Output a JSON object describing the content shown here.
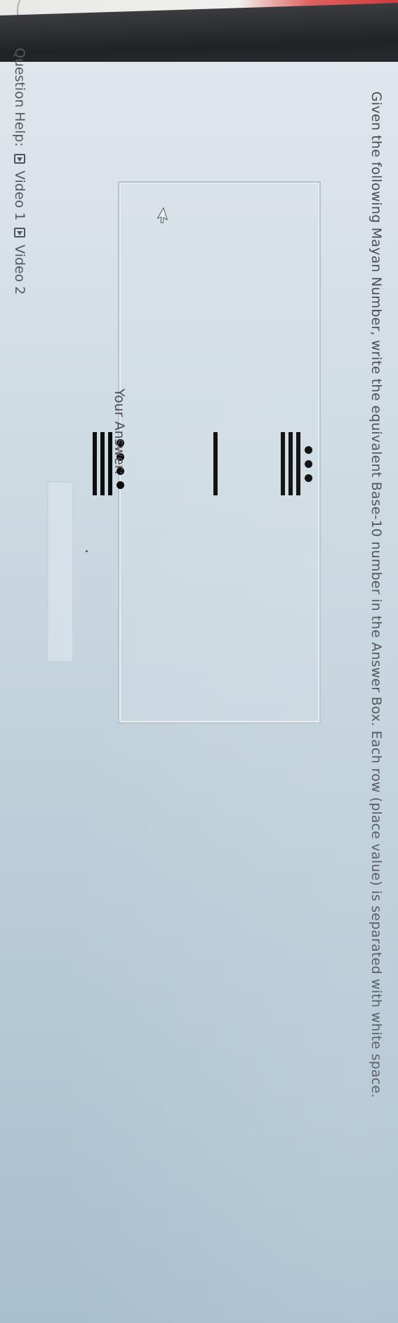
{
  "question": {
    "text": "Given the following Mayan Number, write the equivalent Base-10 number in the Answer Box. Each row (place value) is separated with white space."
  },
  "mayan_number": {
    "rows": [
      {
        "place": "top",
        "dots": 3,
        "bars": 3
      },
      {
        "place": "middle",
        "dots": 0,
        "bars": 1
      },
      {
        "place": "bottom",
        "dots": 4,
        "bars": 3
      }
    ]
  },
  "answer": {
    "label": "Your Answer:",
    "value": "",
    "placeholder": ""
  },
  "help": {
    "label": "Question Help:",
    "links": [
      "Video 1",
      "Video 2"
    ]
  },
  "icons": {
    "cursor": "mouse-pointer-icon",
    "video": "video-icon"
  }
}
